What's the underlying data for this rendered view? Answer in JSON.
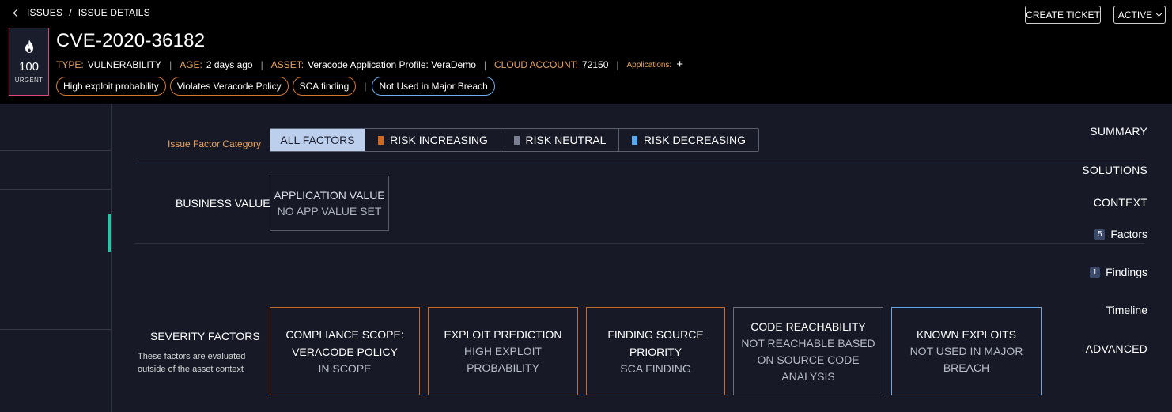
{
  "breadcrumb": {
    "parent": "ISSUES",
    "separator": "/",
    "current": "ISSUE DETAILS"
  },
  "header_actions": {
    "create_ticket": "CREATE TICKET",
    "status": "ACTIVE"
  },
  "score": {
    "value": "100",
    "severity": "URGENT",
    "icon": "flame-icon",
    "border_color": "#e0457f"
  },
  "issue": {
    "title": "CVE-2020-36182",
    "meta": [
      {
        "key": "TYPE:",
        "value": "VULNERABILITY"
      },
      {
        "key": "AGE:",
        "value": "2 days ago"
      },
      {
        "key": "ASSET:",
        "value": "Veracode Application Profile: VeraDemo"
      },
      {
        "key": "CLOUD ACCOUNT:",
        "value": "72150"
      }
    ],
    "applications_label": "Applications:",
    "applications_add": "+"
  },
  "tags": {
    "risk": [
      "High exploit probability",
      "Violates Veracode Policy",
      "SCA finding"
    ],
    "separator": "|",
    "neutral": [
      "Not Used in Major Breach"
    ]
  },
  "nav": {
    "summary": "SUMMARY",
    "solutions": "SOLUTIONS",
    "context": "CONTEXT",
    "factors": {
      "count": "5",
      "label": "Factors"
    },
    "findings": {
      "count": "1",
      "label": "Findings"
    },
    "timeline": "Timeline",
    "advanced": "ADVANCED"
  },
  "filter": {
    "label": "Issue Factor Category",
    "options": [
      {
        "label": "ALL FACTORS",
        "active": true
      },
      {
        "label": "RISK INCREASING",
        "swatch": "#d2691e"
      },
      {
        "label": "RISK NEUTRAL",
        "swatch": "#7a7f92"
      },
      {
        "label": "RISK DECREASING",
        "swatch": "#5aa9f0"
      }
    ]
  },
  "business_value": {
    "label": "BUSINESS VALUE",
    "card": {
      "title": "APPLICATION VALUE",
      "value": "NO APP VALUE SET"
    }
  },
  "severity_factors": {
    "label": "SEVERITY FACTORS",
    "description_line1": "These factors are evaluated",
    "description_line2": "outside of the asset context",
    "cards": [
      {
        "title_line1": "COMPLIANCE SCOPE:",
        "title_line2": "VERACODE POLICY",
        "value_line1": "IN SCOPE",
        "value_line2": "",
        "category": "increasing"
      },
      {
        "title_line1": "EXPLOIT PREDICTION",
        "title_line2": "",
        "value_line1": "HIGH EXPLOIT",
        "value_line2": "PROBABILITY",
        "category": "increasing"
      },
      {
        "title_line1": "FINDING SOURCE PRIORITY",
        "title_line2": "",
        "value_line1": "SCA FINDING",
        "value_line2": "",
        "category": "increasing"
      },
      {
        "title_line1": "CODE REACHABILITY",
        "title_line2": "",
        "value_line1": "NOT REACHABLE BASED",
        "value_line2": "ON SOURCE CODE",
        "value_line3": "ANALYSIS",
        "category": "neutral"
      },
      {
        "title_line1": "KNOWN EXPLOITS",
        "title_line2": "",
        "value_line1": "NOT USED IN MAJOR",
        "value_line2": "BREACH",
        "category": "decreasing"
      }
    ]
  },
  "colors": {
    "accent_orange": "#e8a35b",
    "active_nav": "#2fc0a6",
    "risk_increasing": "#c76b2c",
    "risk_neutral": "#6b7080",
    "risk_decreasing": "#67a8e6"
  }
}
